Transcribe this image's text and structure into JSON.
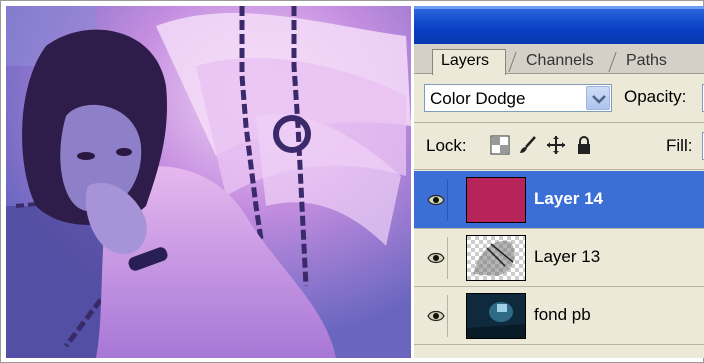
{
  "panel": {
    "tabs": [
      "Layers",
      "Channels",
      "Paths"
    ],
    "active_tab": "Layers",
    "blend_mode": "Color Dodge",
    "opacity_label": "Opacity:",
    "lock_label": "Lock:",
    "fill_label": "Fill:",
    "layers": [
      {
        "name": "Layer 14",
        "selected": true,
        "visible": true,
        "thumb_color": "#b8245a"
      },
      {
        "name": "Layer 13",
        "selected": false,
        "visible": true,
        "thumb_color": "#e8e8e8"
      },
      {
        "name": "fond pb",
        "selected": false,
        "visible": true,
        "thumb_color": "#123245"
      }
    ]
  },
  "colors": {
    "title_blue": "#0a3fc4",
    "selection_blue": "#3b6fd6",
    "panel_bg": "#ece9d8",
    "canvas_tint": "#7a78c8"
  }
}
